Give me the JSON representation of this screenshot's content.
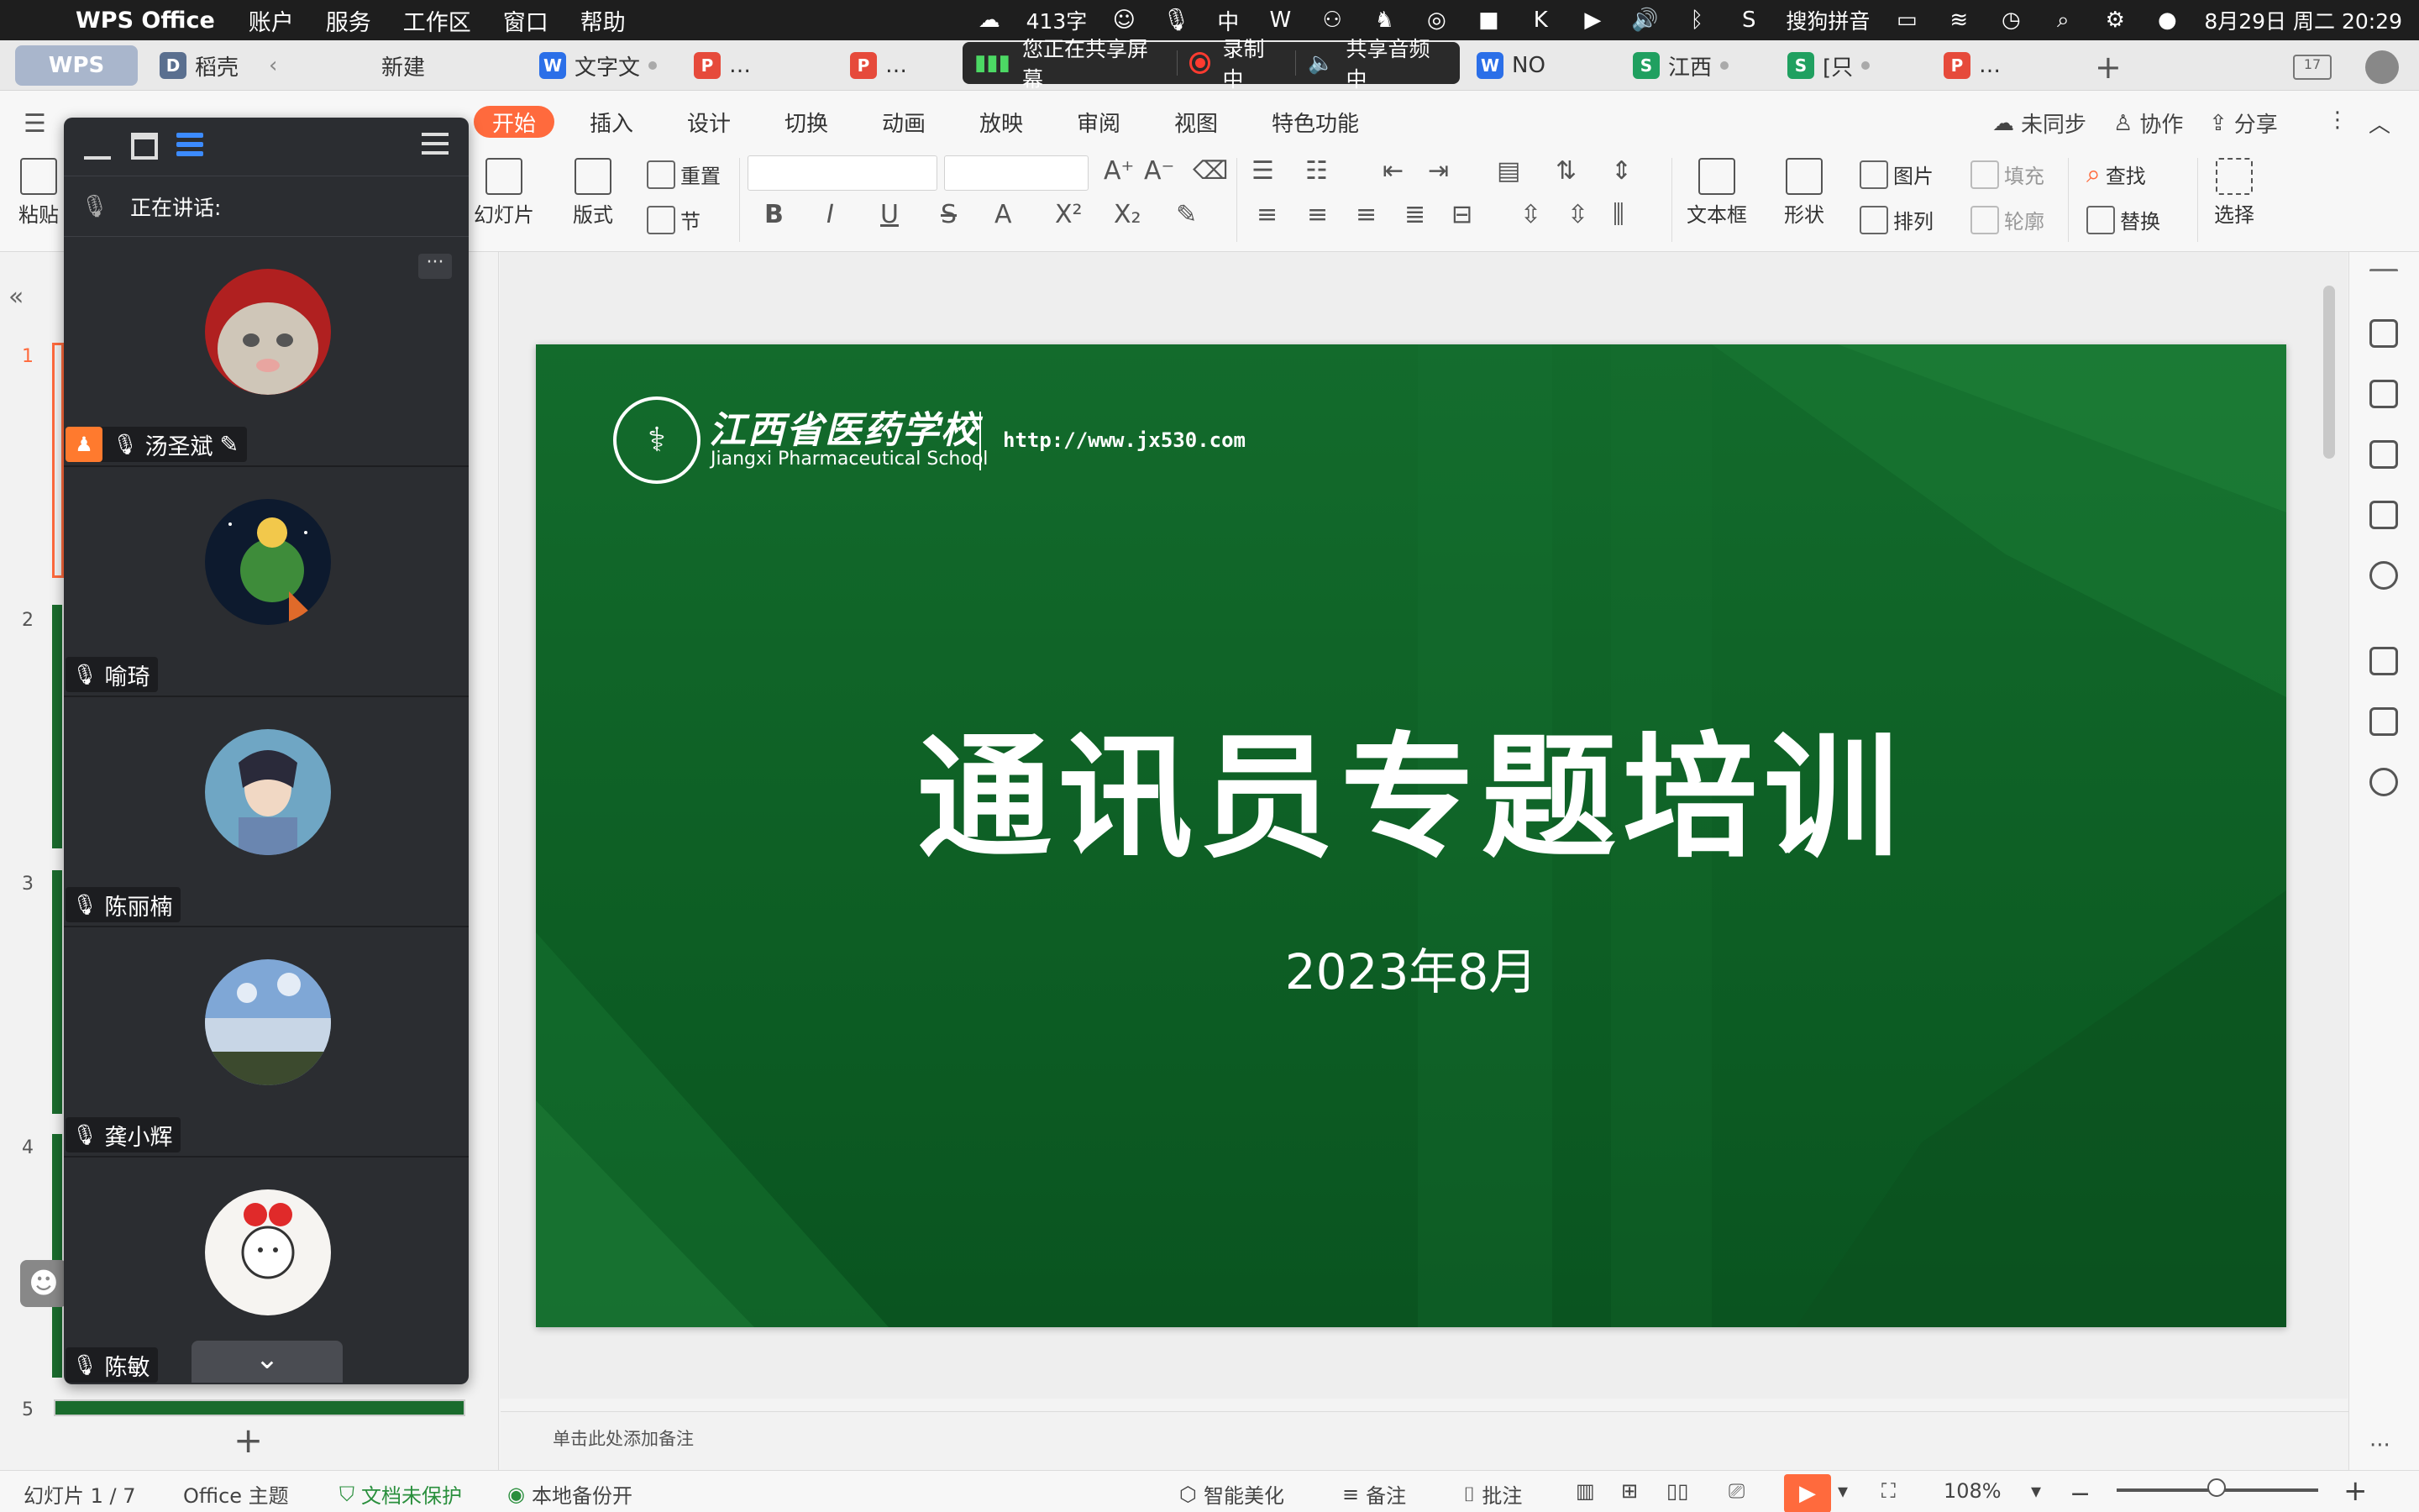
{
  "menubar": {
    "app_name": "WPS Office",
    "menus": [
      "账户",
      "服务",
      "工作区",
      "窗口",
      "帮助"
    ],
    "word_count": "413字",
    "input_method": "搜狗拼音",
    "datetime": "8月29日 周二  20:29"
  },
  "tabs": {
    "wps_label": "WPS",
    "items": [
      {
        "label": "稻壳",
        "icon": "d"
      },
      {
        "label": "新建",
        "icon": ""
      },
      {
        "label": "文字文",
        "icon": "w"
      },
      {
        "label": "…",
        "icon": "p"
      },
      {
        "label": "…",
        "icon": "p"
      },
      {
        "label": "NO",
        "icon": "w"
      },
      {
        "label": "江西",
        "icon": "s"
      },
      {
        "label": "[只",
        "icon": "s"
      },
      {
        "label": "…",
        "icon": "p"
      }
    ],
    "calendar_day": "17"
  },
  "share": {
    "sharing_text": "您正在共享屏幕",
    "recording_text": "录制中",
    "audio_text": "共享音频中"
  },
  "ribbon": {
    "tabs": [
      "开始",
      "插入",
      "设计",
      "切换",
      "动画",
      "放映",
      "审阅",
      "视图",
      "特色功能"
    ],
    "active_tab": "开始",
    "sync": "未同步",
    "collab": "协作",
    "share": "分享",
    "tools": {
      "paste": "粘贴",
      "slide": "幻灯片",
      "layout": "版式",
      "reset": "重置",
      "section": "节",
      "textbox": "文本框",
      "shape": "形状",
      "picture": "图片",
      "arrange": "排列",
      "fill": "填充",
      "outline": "轮廓",
      "find": "查找",
      "replace": "替换",
      "select": "选择"
    }
  },
  "meeting": {
    "speaking_label": "正在讲话:",
    "participants": [
      {
        "name": "汤圣斌",
        "host": true
      },
      {
        "name": "喻琦",
        "host": false
      },
      {
        "name": "陈丽楠",
        "host": false
      },
      {
        "name": "龚小辉",
        "host": false
      },
      {
        "name": "陈敏",
        "host": false
      }
    ]
  },
  "slide": {
    "school_cn": "江西省医药学校",
    "school_en": "Jiangxi Pharmaceutical School",
    "url": "http://www.jx530.com",
    "title": "通讯员专题培训",
    "date": "2023年8月"
  },
  "thumbnails": [
    "1",
    "2",
    "3",
    "4",
    "5"
  ],
  "notes_placeholder": "单击此处添加备注",
  "status": {
    "slide_info": "幻灯片 1 / 7",
    "theme": "Office 主题",
    "protect": "文档未保护",
    "backup": "本地备份开",
    "beautify": "智能美化",
    "notes": "备注",
    "comments": "批注",
    "zoom": "108%"
  },
  "colors": {
    "accent": "#ff6a3d",
    "slide_green": "#0f6428",
    "meeting_bg": "#2b2d31"
  }
}
